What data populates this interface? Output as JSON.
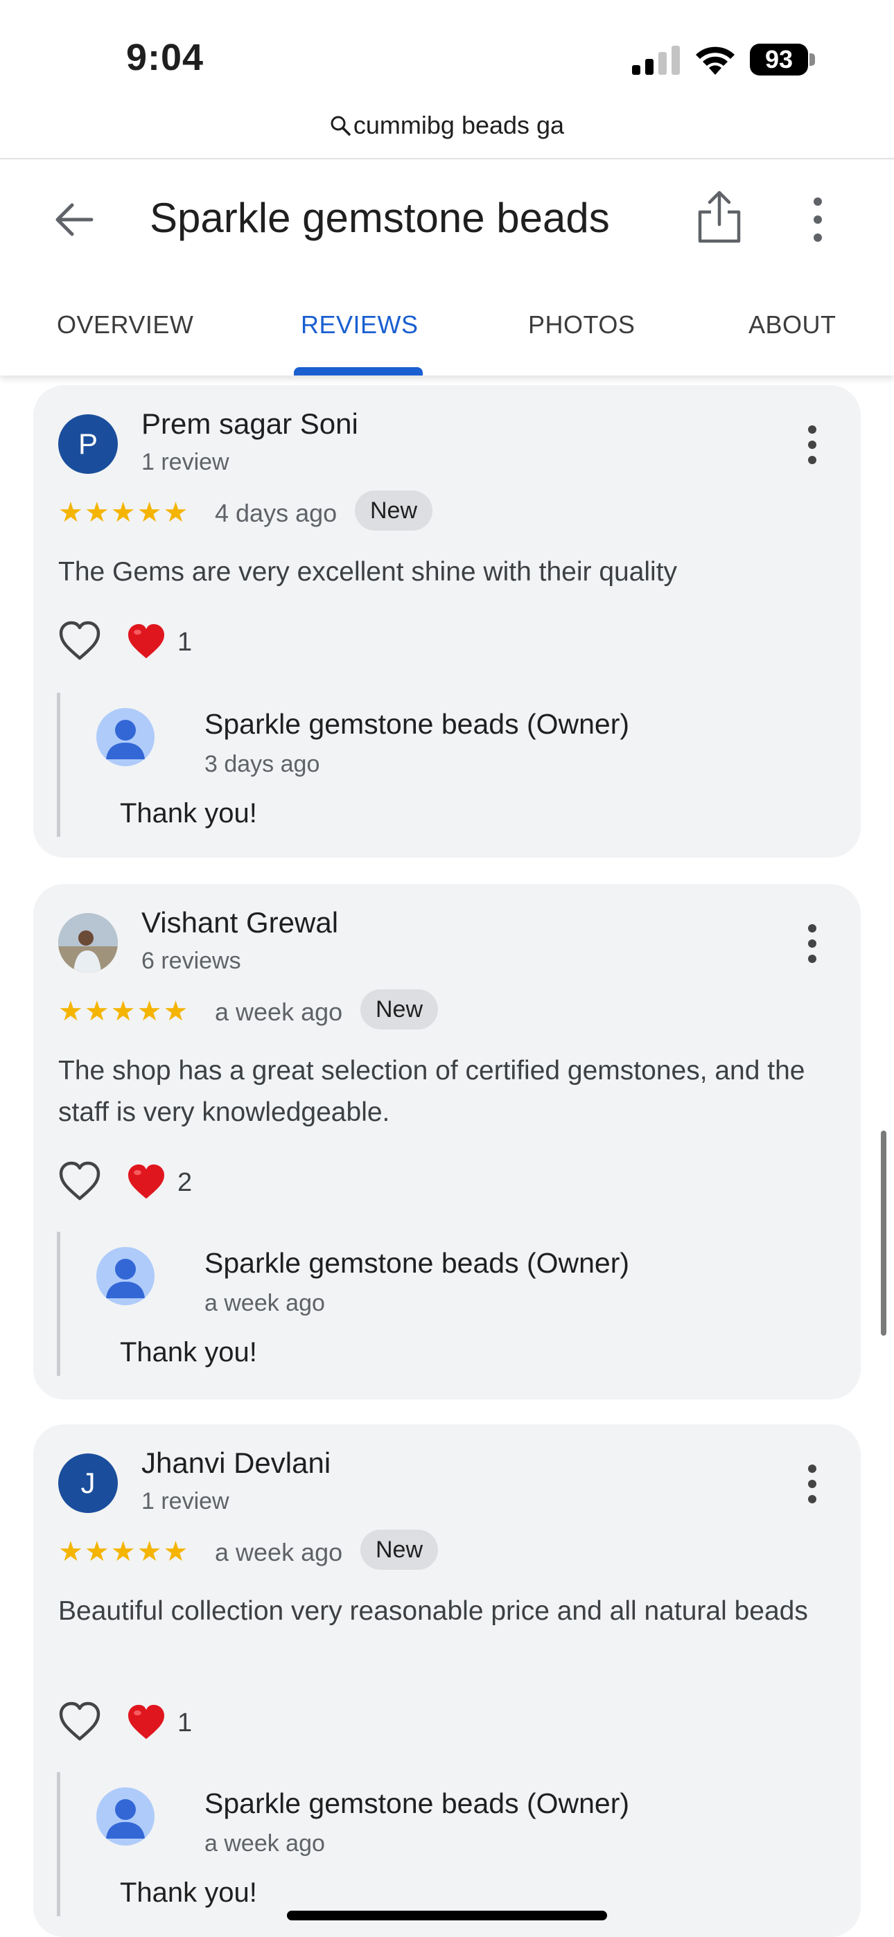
{
  "status_bar": {
    "time": "9:04",
    "battery": "93"
  },
  "url_bar": {
    "text": "cummibg beads ga"
  },
  "header": {
    "title": "Sparkle gemstone beads"
  },
  "tabs": [
    {
      "label": "OVERVIEW",
      "active": false
    },
    {
      "label": "REVIEWS",
      "active": true
    },
    {
      "label": "PHOTOS",
      "active": false
    },
    {
      "label": "ABOUT",
      "active": false
    }
  ],
  "reviews": [
    {
      "avatar_letter": "P",
      "name": "Prem sagar Soni",
      "meta": "1 review",
      "stars": "★★★★★",
      "rating": 5,
      "date": "4 days ago",
      "badge": "New",
      "text": "The Gems are very excellent shine with their quality",
      "like_count": "1",
      "reply": {
        "name": "Sparkle gemstone beads (Owner)",
        "date": "3 days ago",
        "text": "Thank you!"
      }
    },
    {
      "avatar_letter": "",
      "name": "Vishant Grewal",
      "meta": "6 reviews",
      "stars": "★★★★★",
      "rating": 5,
      "date": "a week ago",
      "badge": "New",
      "text": "The shop has a great selection of certified gemstones, and the staff is very knowledgeable.",
      "like_count": "2",
      "reply": {
        "name": "Sparkle gemstone beads (Owner)",
        "date": "a week ago",
        "text": "Thank you!"
      }
    },
    {
      "avatar_letter": "J",
      "name": "Jhanvi Devlani",
      "meta": "1 review",
      "stars": "★★★★★",
      "rating": 5,
      "date": "a week ago",
      "badge": "New",
      "text": "Beautiful collection very reasonable price and all natural beads",
      "like_count": "1",
      "reply": {
        "name": "Sparkle gemstone beads (Owner)",
        "date": "a week ago",
        "text": "Thank you!"
      }
    }
  ],
  "colors": {
    "accent": "#1a5fd0",
    "star": "#f4b400",
    "card_bg": "#f2f3f5",
    "heart": "#e0161e"
  }
}
